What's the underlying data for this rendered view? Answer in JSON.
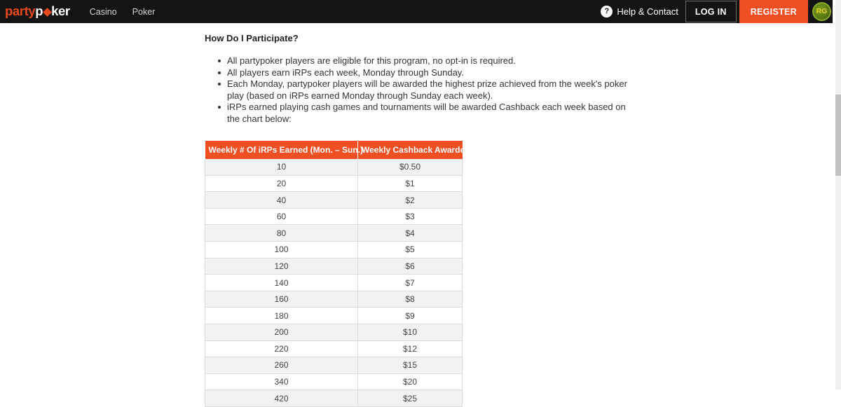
{
  "header": {
    "logo": {
      "part1": "party",
      "part2": "p",
      "diamond_icon": "diamond-icon",
      "part3": "ker"
    },
    "nav": [
      {
        "label": "Casino"
      },
      {
        "label": "Poker"
      }
    ],
    "help": {
      "icon": "question-mark-icon",
      "label": "Help & Contact"
    },
    "login_label": "LOG IN",
    "register_label": "REGISTER",
    "rg_badge_label": "RG",
    "colors": {
      "bar_background": "#131313",
      "accent_orange": "#F04E23",
      "logo_orange": "#E8491E"
    }
  },
  "main": {
    "heading": "How Do I Participate?",
    "bullets": [
      "All partypoker players are eligible for this program, no opt-in is required.",
      "All players earn iRPs each week, Monday through Sunday.",
      "Each Monday, partypoker players will be awarded the highest prize achieved from the week's poker play (based on iRPs earned Monday through Sunday each week).",
      "iRPs earned playing cash games and tournaments will be awarded Cashback each week based on the chart below:"
    ],
    "table": {
      "columns": [
        "Weekly # Of iRPs Earned (Mon. – Sun.)",
        "Weekly Cashback Awarded"
      ],
      "rows": [
        [
          "10",
          "$0.50"
        ],
        [
          "20",
          "$1"
        ],
        [
          "40",
          "$2"
        ],
        [
          "60",
          "$3"
        ],
        [
          "80",
          "$4"
        ],
        [
          "100",
          "$5"
        ],
        [
          "120",
          "$6"
        ],
        [
          "140",
          "$7"
        ],
        [
          "160",
          "$8"
        ],
        [
          "180",
          "$9"
        ],
        [
          "200",
          "$10"
        ],
        [
          "220",
          "$12"
        ],
        [
          "260",
          "$15"
        ],
        [
          "340",
          "$20"
        ],
        [
          "420",
          "$25"
        ]
      ]
    }
  },
  "scrollbar": {
    "name": "vertical-scrollbar"
  }
}
